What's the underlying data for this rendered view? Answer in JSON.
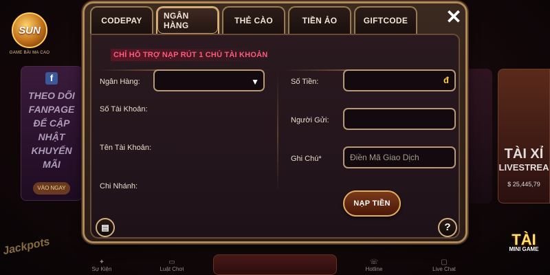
{
  "background": {
    "logo_text": "SUN",
    "logo_tagline": "GAME BÀI MA CAO",
    "promo_lines": [
      "THEO DÕI",
      "FANPAGE",
      "ĐỂ CẬP NHẬT",
      "KHUYẾN MÃI"
    ],
    "promo_cta": "VÀO NGAY",
    "right_card_big": "TÀI XỈ",
    "right_card_small": "LIVESTREA",
    "right_card_count": "$ 25,445,79",
    "jackpot_text": "Jackpots",
    "nav": [
      "Sự Kiện",
      "Luật Chơi",
      "Hotline",
      "Live Chat"
    ],
    "tai_label": "TÀI",
    "tai_sub": "MINI GAME"
  },
  "modal": {
    "tabs": [
      {
        "label": "CODEPAY"
      },
      {
        "label": "NGÂN HÀNG"
      },
      {
        "label": "THẺ CÀO"
      },
      {
        "label": "TIỀN ẢO"
      },
      {
        "label": "GIFTCODE"
      }
    ],
    "active_tab": "NGÂN HÀNG",
    "close_glyph": "✕",
    "notice": "CHỈ HỖ TRỢ NẠP RÚT 1 CHỦ TÀI KHOẢN",
    "left": {
      "bank_label": "Ngân Hàng:",
      "bank_value": "",
      "account_number_label": "Số Tài Khoản:",
      "account_name_label": "Tên Tài Khoản:",
      "branch_label": "Chi Nhánh:"
    },
    "right": {
      "amount_label": "Số Tiền:",
      "amount_value": "",
      "currency": "đ",
      "sender_label": "Người Gửi:",
      "sender_value": "",
      "note_label": "Ghi Chú*",
      "note_placeholder": "Điền Mã Giao Dịch"
    },
    "deposit_button": "NẠP TIỀN",
    "history_icon": "receipt-icon",
    "help_glyph": "?"
  },
  "colors": {
    "accent_gold": "#d8b27a",
    "notice_red": "#ff5a7a",
    "currency_gold": "#ffcc44"
  }
}
